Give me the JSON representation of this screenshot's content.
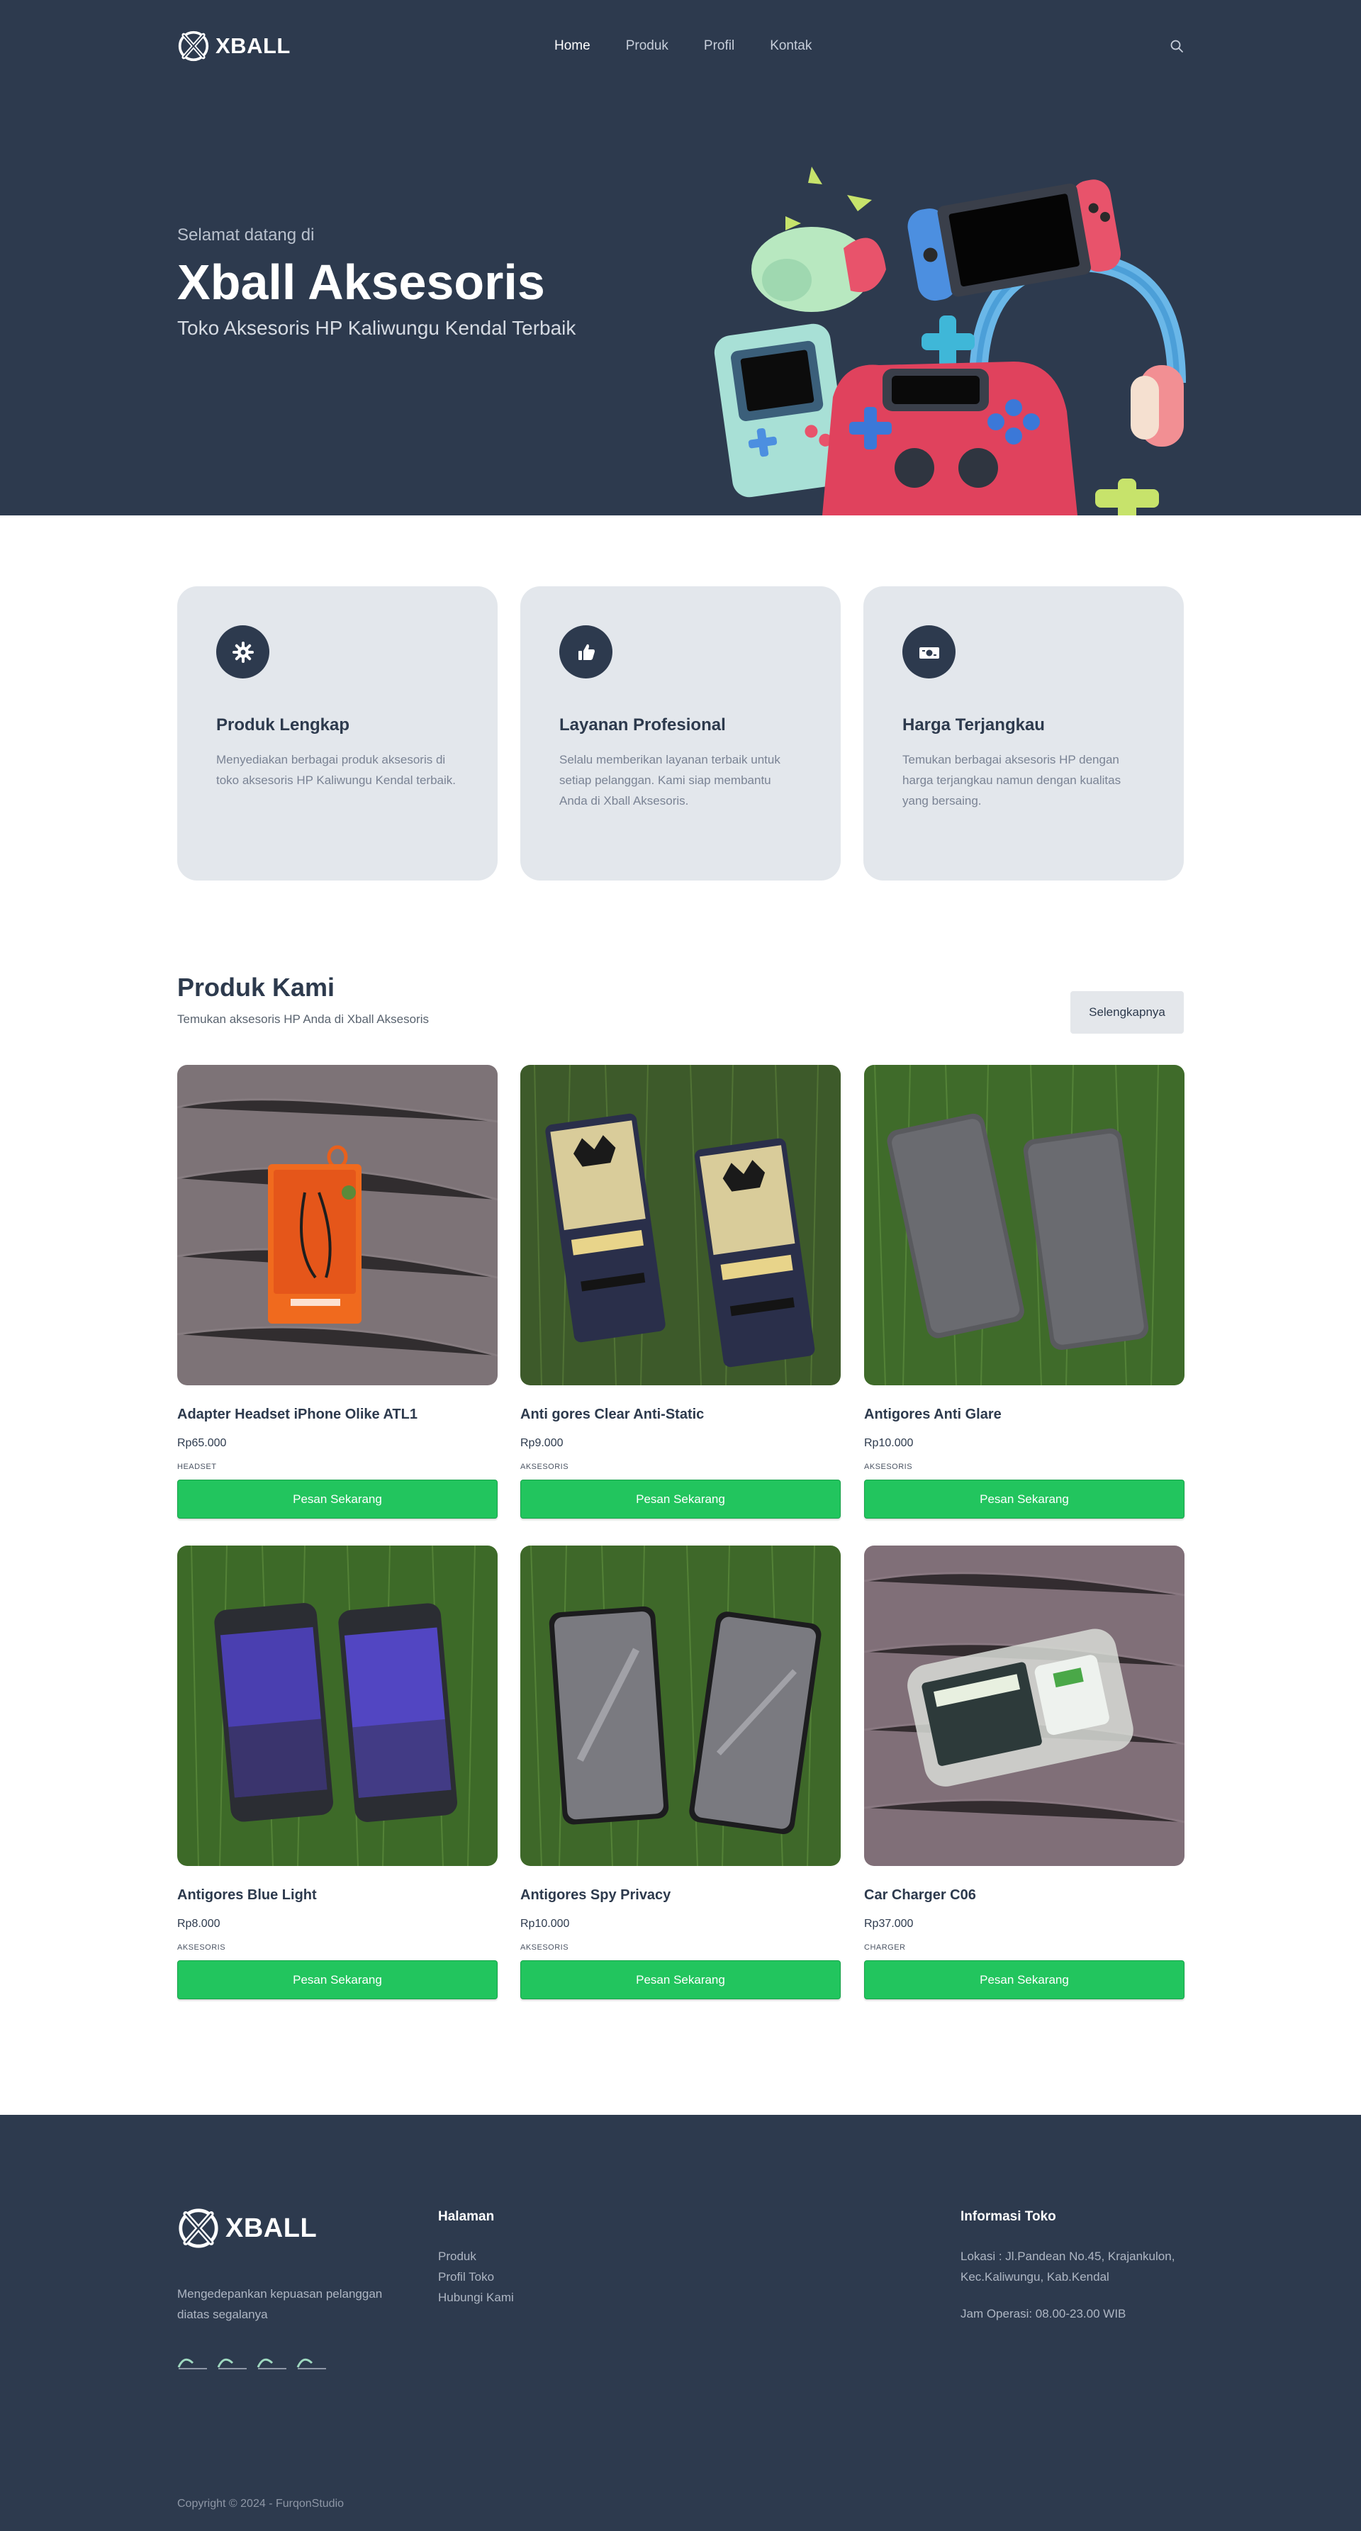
{
  "header": {
    "brand": "XBALL",
    "nav": [
      "Home",
      "Produk",
      "Profil",
      "Kontak"
    ],
    "active_nav": "Home"
  },
  "hero": {
    "welcome": "Selamat datang di",
    "title": "Xball Aksesoris",
    "subtitle": "Toko Aksesoris HP Kaliwungu Kendal Terbaik"
  },
  "features": [
    {
      "icon": "gear-icon",
      "title": "Produk Lengkap",
      "desc": "Menyediakan berbagai produk aksesoris di toko aksesoris HP Kaliwungu Kendal terbaik."
    },
    {
      "icon": "thumbs-up-icon",
      "title": "Layanan Profesional",
      "desc": "Selalu memberikan layanan terbaik untuk setiap pelanggan. Kami siap membantu Anda di Xball Aksesoris."
    },
    {
      "icon": "money-icon",
      "title": "Harga Terjangkau",
      "desc": "Temukan berbagai aksesoris HP dengan harga terjangkau namun dengan kualitas yang bersaing."
    }
  ],
  "products_section": {
    "title": "Produk Kami",
    "subtitle": "Temukan aksesoris HP Anda di Xball Aksesoris",
    "more_label": "Selengkapnya",
    "order_label": "Pesan Sekarang",
    "items": [
      {
        "name": "Adapter Headset iPhone Olike ATL1",
        "price": "Rp65.000",
        "category": "HEADSET"
      },
      {
        "name": "Anti gores Clear Anti-Static",
        "price": "Rp9.000",
        "category": "AKSESORIS"
      },
      {
        "name": "Antigores Anti Glare",
        "price": "Rp10.000",
        "category": "AKSESORIS"
      },
      {
        "name": "Antigores Blue Light",
        "price": "Rp8.000",
        "category": "AKSESORIS"
      },
      {
        "name": "Antigores Spy Privacy",
        "price": "Rp10.000",
        "category": "AKSESORIS"
      },
      {
        "name": "Car Charger C06",
        "price": "Rp37.000",
        "category": "CHARGER"
      }
    ]
  },
  "footer": {
    "brand": "XBALL",
    "tagline": "Mengedepankan kepuasan pelanggan diatas segalanya",
    "pages_heading": "Halaman",
    "pages": [
      "Produk",
      "Profil Toko",
      "Hubungi Kami"
    ],
    "info_heading": "Informasi Toko",
    "address": "Lokasi : Jl.Pandean No.45, Krajankulon, Kec.Kaliwungu, Kab.Kendal",
    "hours": "Jam Operasi: 08.00-23.00 WIB",
    "copyright": "Copyright © 2024 - FurqonStudio"
  },
  "colors": {
    "navy": "#2d3a4e",
    "card_bg": "#e3e7ec",
    "order_green": "#22c55e"
  }
}
